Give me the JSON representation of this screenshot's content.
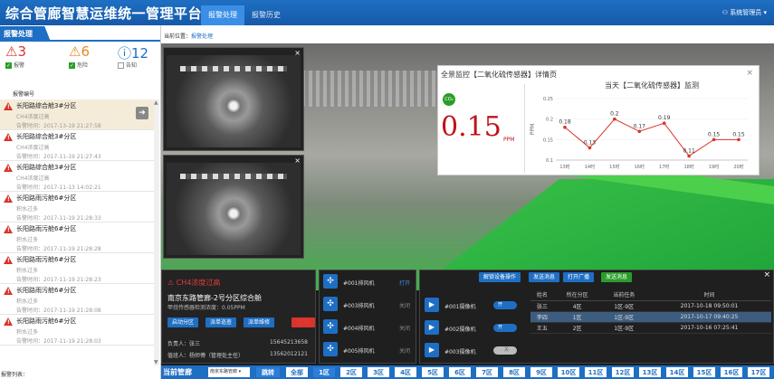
{
  "header": {
    "title": "综合管廊智慧运维统一管理平台",
    "tabs": [
      "报警处理",
      "报警历史"
    ],
    "user": "系统管理员"
  },
  "left": {
    "tab": "报警处理",
    "counts": [
      {
        "value": "3",
        "label": "报警",
        "color": "#d9342b",
        "checked": true
      },
      {
        "value": "6",
        "label": "危险",
        "color": "#e58a1f",
        "checked": true
      },
      {
        "value": "12",
        "label": "告知",
        "color": "#1e6fc4",
        "checked": false
      }
    ],
    "list_header": "报警编号",
    "alerts": [
      {
        "title": "长阳路综合舱3#分区",
        "sub": "CH4浓度过高",
        "time": "告警时间：2017-13-19 21:27:58"
      },
      {
        "title": "长阳路综合舱3#分区",
        "sub": "CH4浓度过高",
        "time": "告警时间：2017-11-19 21:27:43"
      },
      {
        "title": "长阳路综合舱3#分区",
        "sub": "CH4浓度过高",
        "time": "告警时间：2017-11-13 14:02:21"
      },
      {
        "title": "长阳路雨污舱6#分区",
        "sub": "积水过多",
        "time": "告警时间：2017-11-19 21:28:33"
      },
      {
        "title": "长阳路雨污舱6#分区",
        "sub": "积水过多",
        "time": "告警时间：2017-11-19 21:28:28"
      },
      {
        "title": "长阳路雨污舱6#分区",
        "sub": "积水过多",
        "time": "告警时间：2017-11-19 21:28:23"
      },
      {
        "title": "长阳路雨污舱6#分区",
        "sub": "积水过多",
        "time": "告警时间：2017-11-19 21:28:08"
      },
      {
        "title": "长阳路雨污舱6#分区",
        "sub": "积水过多",
        "time": "告警时间：2017-11-19 21:28:03"
      }
    ],
    "footer": "报警列表："
  },
  "crumb": {
    "prefix": "当前位置：",
    "link": "报警处理"
  },
  "monitor": {
    "title": "全景监控【二氧化硫传感器】详情页",
    "badge": "CO₂",
    "value": "0.15",
    "unit": "PPM",
    "chart_data": {
      "type": "line",
      "title": "当天【二氧化硫传感器】监测",
      "ylabel": "PPM",
      "categories": [
        "13时",
        "14时",
        "15时",
        "16时",
        "17时",
        "18时",
        "19时",
        "20时"
      ],
      "values": [
        0.18,
        0.13,
        0.2,
        0.17,
        0.19,
        0.11,
        0.15,
        0.15
      ],
      "yticks": [
        "0.25",
        "0.2",
        "0.15",
        "0.1"
      ],
      "ylim": [
        0.1,
        0.25
      ],
      "color": "#d9342b"
    }
  },
  "alarm_panel": {
    "title": "CH4浓度过高",
    "location": "南京东路管廊-2号分区综合舱",
    "device": "甲烷传感器检测浓度：0.05PPM",
    "buttons": [
      "启动分区",
      "派单巡查",
      "派单维修",
      "忽略"
    ],
    "person1": {
      "label": "负责人：",
      "name": "张三",
      "phone": "15645213658"
    },
    "person2": {
      "label": "值班人：",
      "name": "杨师傅（管理处主任）",
      "phone": "13562012121"
    }
  },
  "fans": [
    {
      "name": "#001排风机",
      "status": "打开"
    },
    {
      "name": "#003排风机",
      "status": "关闭"
    },
    {
      "name": "#004排风机",
      "status": "关闭"
    },
    {
      "name": "#005排风机",
      "status": "关闭"
    }
  ],
  "actions": [
    "解锁设备操作",
    "发送消息",
    "打开广播",
    "发送消息"
  ],
  "pumps": [
    {
      "name": "#001摄像机",
      "state": "开"
    },
    {
      "name": "#002摄像机",
      "state": "开"
    },
    {
      "name": "#003摄像机",
      "state": "关"
    }
  ],
  "staff_table": {
    "headers": [
      "姓名",
      "所在分区",
      "当前任务",
      "时间"
    ],
    "rows": [
      [
        "张三",
        "4区",
        "1区-9区",
        "2017-10-18 09:50:01"
      ],
      [
        "李四",
        "1区",
        "1区-9区",
        "2017-10-17 09:40:25"
      ],
      [
        "王五",
        "2区",
        "1区-9区",
        "2017-10-16 07:25:41"
      ]
    ]
  },
  "zones": {
    "label": "当前管廊",
    "select": "南京东路管廊",
    "confirm": "跳转",
    "items": [
      "全部",
      "1区",
      "2区",
      "3区",
      "4区",
      "5区",
      "6区",
      "7区",
      "8区",
      "9区",
      "10区",
      "11区",
      "12区",
      "13区",
      "14区",
      "15区",
      "16区",
      "17区"
    ],
    "active": "1区"
  }
}
